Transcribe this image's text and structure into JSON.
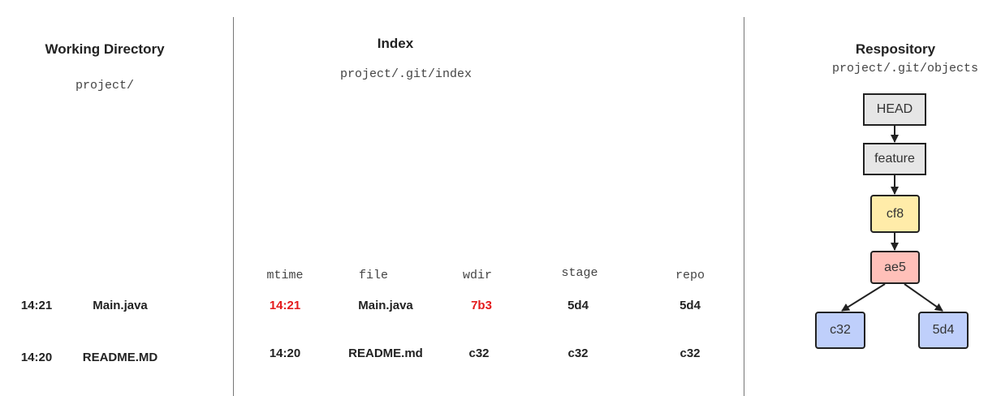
{
  "working": {
    "title": "Working Directory",
    "path": "project/",
    "rows": [
      {
        "time": "14:21",
        "file": "Main.java"
      },
      {
        "time": "14:20",
        "file": "README.MD"
      }
    ]
  },
  "index": {
    "title": "Index",
    "path": "project/.git/index",
    "columns": [
      "mtime",
      "file",
      "wdir",
      "stage",
      "repo"
    ],
    "rows": [
      {
        "mtime": "14:21",
        "file": "Main.java",
        "wdir": "7b3",
        "stage": "5d4",
        "repo": "5d4"
      },
      {
        "mtime": "14:20",
        "file": "README.md",
        "wdir": "c32",
        "stage": "c32",
        "repo": "c32"
      }
    ]
  },
  "repository": {
    "title": "Respository",
    "path": "project/.git/objects",
    "nodes": {
      "head": "HEAD",
      "feature": "feature",
      "cf8": "cf8",
      "ae5": "ae5",
      "c32": "c32",
      "d54": "5d4"
    }
  },
  "colors": {
    "changed": "#e41a1c",
    "ref_fill": "#e6e6e6",
    "commit_fill": "#ffeca9",
    "current_fill": "#ffc0b9",
    "blob_fill": "#bfcffb"
  }
}
